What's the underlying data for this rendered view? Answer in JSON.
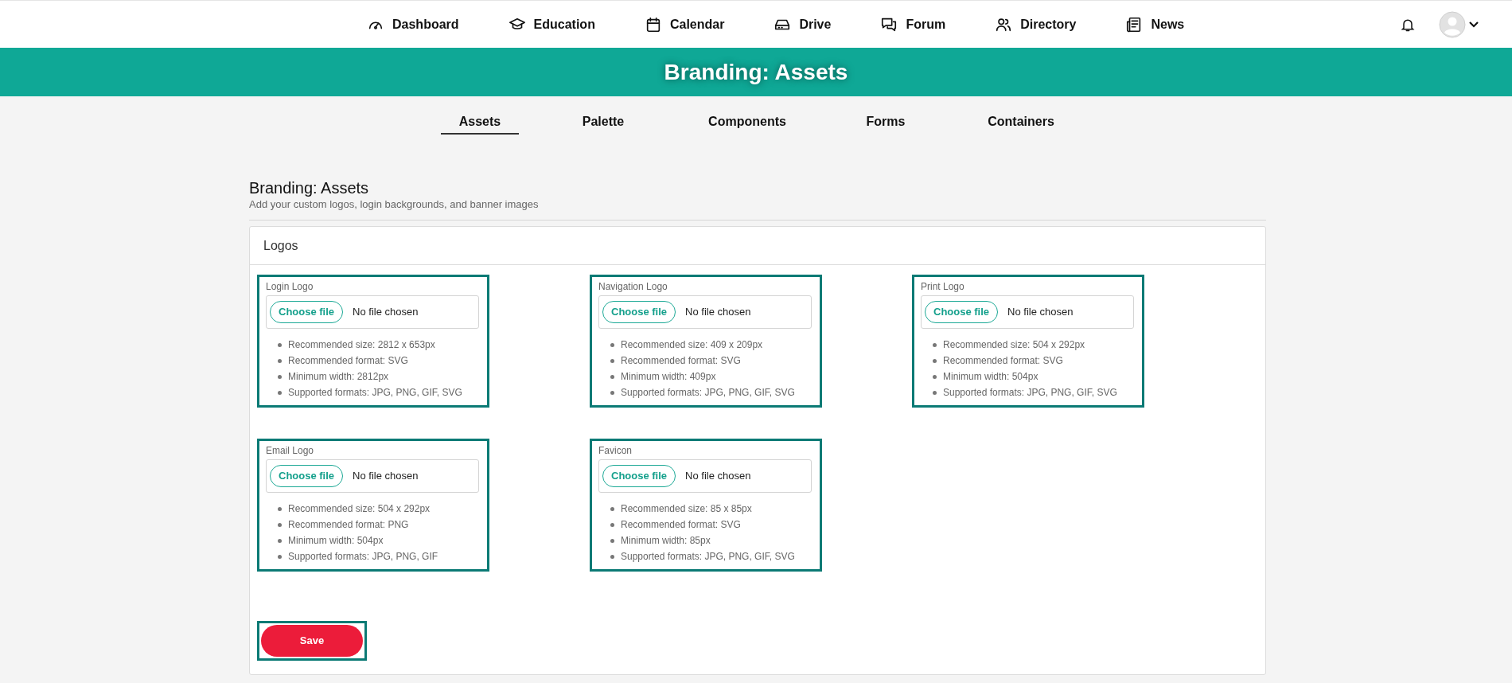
{
  "nav": {
    "items": [
      {
        "label": "Dashboard"
      },
      {
        "label": "Education"
      },
      {
        "label": "Calendar"
      },
      {
        "label": "Drive"
      },
      {
        "label": "Forum"
      },
      {
        "label": "Directory"
      },
      {
        "label": "News"
      }
    ]
  },
  "banner": {
    "title": "Branding: Assets"
  },
  "tabs": [
    {
      "label": "Assets",
      "selected": true
    },
    {
      "label": "Palette",
      "selected": false
    },
    {
      "label": "Components",
      "selected": false
    },
    {
      "label": "Forms",
      "selected": false
    },
    {
      "label": "Containers",
      "selected": false
    }
  ],
  "page": {
    "title": "Branding: Assets",
    "subtitle": "Add your custom logos, login backgrounds, and banner images"
  },
  "section": {
    "title": "Logos",
    "uploads": [
      {
        "label": "Login Logo",
        "button": "Choose file",
        "status": "No file chosen",
        "highlighted": true,
        "notes": [
          "Recommended size: 2812 x 653px",
          "Recommended format: SVG",
          "Minimum width: 2812px",
          "Supported formats: JPG, PNG, GIF, SVG"
        ]
      },
      {
        "label": "Navigation Logo",
        "button": "Choose file",
        "status": "No file chosen",
        "highlighted": true,
        "notes": [
          "Recommended size: 409 x 209px",
          "Recommended format: SVG",
          "Minimum width: 409px",
          "Supported formats: JPG, PNG, GIF, SVG"
        ]
      },
      {
        "label": "Print Logo",
        "button": "Choose file",
        "status": "No file chosen",
        "highlighted": true,
        "notes": [
          "Recommended size: 504 x 292px",
          "Recommended format: SVG",
          "Minimum width: 504px",
          "Supported formats: JPG, PNG, GIF, SVG"
        ]
      },
      {
        "label": "Email Logo",
        "button": "Choose file",
        "status": "No file chosen",
        "highlighted": true,
        "notes": [
          "Recommended size: 504 x 292px",
          "Recommended format: PNG",
          "Minimum width: 504px",
          "Supported formats: JPG, PNG, GIF"
        ]
      },
      {
        "label": "Favicon",
        "button": "Choose file",
        "status": "No file chosen",
        "highlighted": true,
        "notes": [
          "Recommended size: 85 x 85px",
          "Recommended format: SVG",
          "Minimum width: 85px",
          "Supported formats: JPG, PNG, GIF, SVG"
        ]
      }
    ],
    "save": {
      "label": "Save",
      "highlighted": true
    }
  }
}
